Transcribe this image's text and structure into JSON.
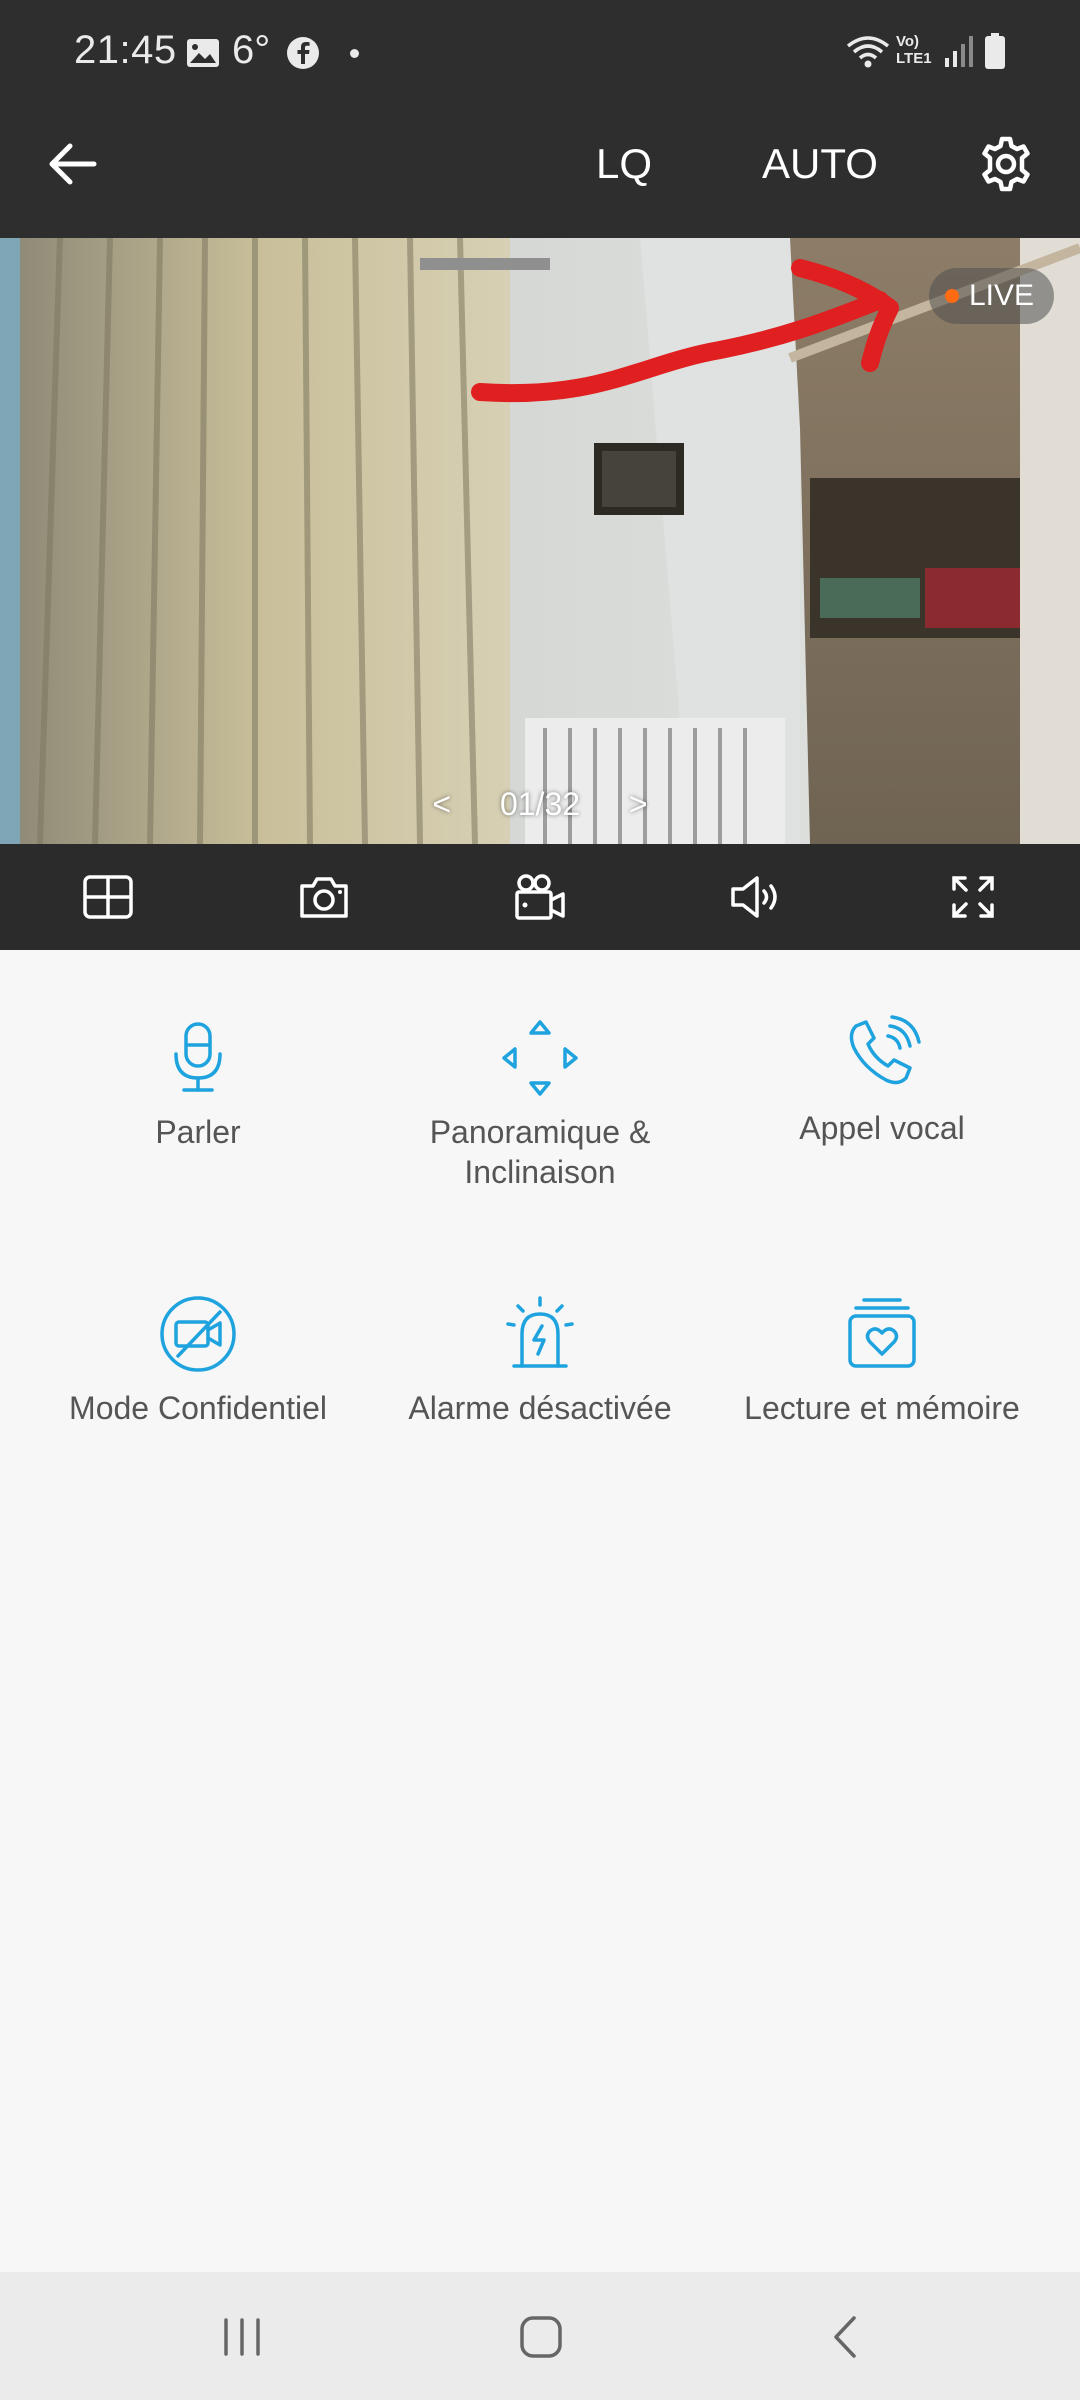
{
  "status_bar": {
    "time": "21:45",
    "temperature": "6°",
    "network_text": "Vo) LTE1"
  },
  "app_bar": {
    "quality": "LQ",
    "mode": "AUTO"
  },
  "video": {
    "live_label": "LIVE",
    "page_prev": "<",
    "page_indicator": "01/32",
    "page_next": ">"
  },
  "controls": [
    "grid-view-icon",
    "snapshot-icon",
    "record-icon",
    "speaker-icon",
    "fullscreen-icon"
  ],
  "features": [
    {
      "icon": "microphone-icon",
      "label": "Parler"
    },
    {
      "icon": "pan-tilt-icon",
      "label": "Panoramique & Inclinaison"
    },
    {
      "icon": "voice-call-icon",
      "label": "Appel vocal"
    },
    {
      "icon": "privacy-camera-off-icon",
      "label": "Mode Confidentiel"
    },
    {
      "icon": "alarm-siren-icon",
      "label": "Alarme désactivée"
    },
    {
      "icon": "playback-memory-icon",
      "label": "Lecture et mémoire"
    }
  ],
  "colors": {
    "accent": "#1fa3df",
    "bar_bg": "#2e2e2e",
    "live_dot": "#ff6a13",
    "annotation": "#e02020"
  }
}
